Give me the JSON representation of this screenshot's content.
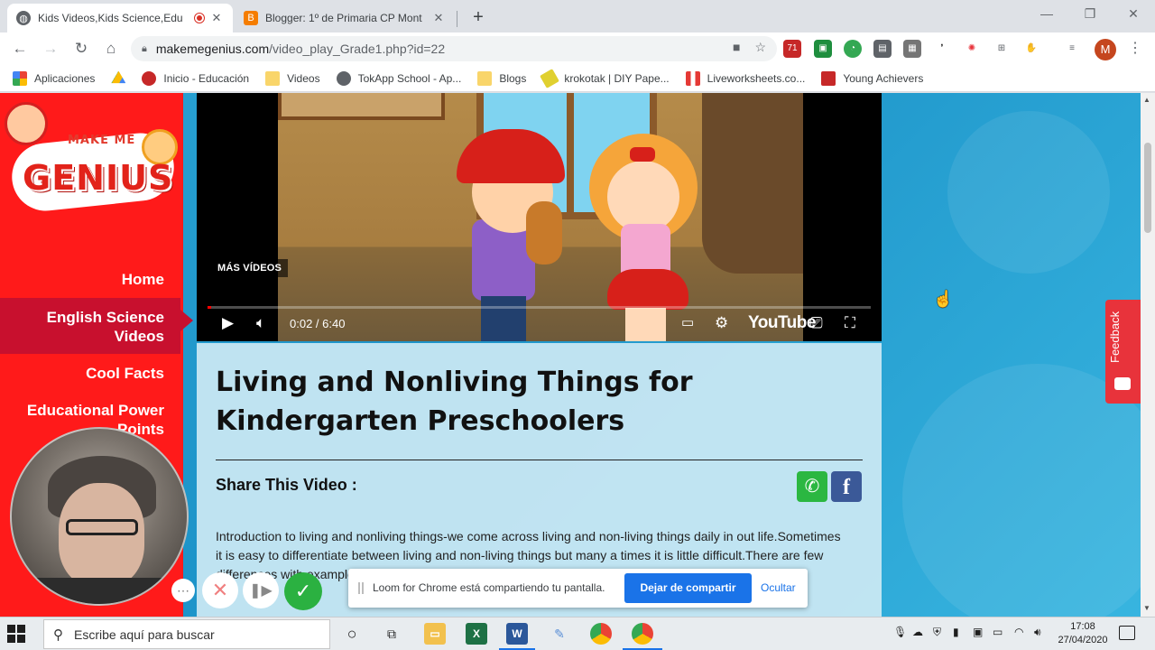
{
  "browser": {
    "tabs": [
      {
        "title": "Kids Videos,Kids Science,Edu",
        "recording": true,
        "active": true
      },
      {
        "title": "Blogger: 1º de Primaria CP Mont",
        "active": false
      }
    ],
    "url_host": "makemegenius.com",
    "url_path": "/video_play_Grade1.php?id=22",
    "profile_initial": "M",
    "extension_badge": "71",
    "bookmarks": [
      "Aplicaciones",
      "",
      "Inicio - Educación",
      "Videos",
      "TokApp School - Ap...",
      "Blogs",
      "krokotak | DIY Pape...",
      "Liveworksheets.co...",
      "Young Achievers"
    ]
  },
  "site": {
    "logo_make": "MAKE ME",
    "logo_genius": "GENIUS",
    "menu": [
      {
        "label": "Home",
        "active": false
      },
      {
        "label": "English Science Videos",
        "active": true
      },
      {
        "label": "Cool Facts",
        "active": false
      },
      {
        "label": "Educational Power Points",
        "active": false
      }
    ],
    "video": {
      "more_videos": "MÁS VÍDEOS",
      "current_time": "0:02",
      "duration": "6:40",
      "timecode": "0:02 / 6:40",
      "progress_fraction": 0.005,
      "brand": "YouTube"
    },
    "card": {
      "title": "Living and Nonliving Things for Kindergarten Preschoolers",
      "share_label": "Share This Video :",
      "description": "Introduction to living and nonliving things-we come across living and non-living things daily in out life.Sometimes it is easy to differentiate between living and non-living things but many a times it is little difficult.There are few differences with examples that we need to know to distinguish living things from"
    },
    "feedback_label": "Feedback"
  },
  "loom": {
    "share_message": "Loom for Chrome está compartiendo tu pantalla.",
    "stop_button": "Dejar de compartir",
    "hide_button": "Ocultar"
  },
  "taskbar": {
    "search_placeholder": "Escribe aquí para buscar",
    "time": "17:08",
    "date": "27/04/2020"
  },
  "colors": {
    "sidebar_red": "#ff1a1a",
    "active_menu": "#c8102e",
    "page_blue": "#2aa3d3",
    "loom_green": "#2bb141",
    "chrome_blue": "#1a73e8"
  }
}
